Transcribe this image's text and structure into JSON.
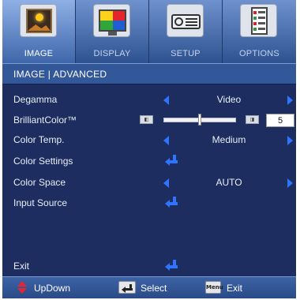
{
  "tabs": [
    {
      "label": "IMAGE",
      "icon": "image-icon",
      "active": true
    },
    {
      "label": "DISPLAY",
      "icon": "display-icon",
      "active": false
    },
    {
      "label": "SETUP",
      "icon": "projector-icon",
      "active": false
    },
    {
      "label": "OPTIONS",
      "icon": "checklist-icon",
      "active": false
    }
  ],
  "menu_title": "IMAGE | ADVANCED",
  "rows": {
    "degamma": {
      "label": "Degamma",
      "value": "Video"
    },
    "brilliantcolor": {
      "label": "BrilliantColor™",
      "value": "5",
      "level_fraction": 0.5
    },
    "color_temp": {
      "label": "Color Temp.",
      "value": "Medium"
    },
    "color_settings": {
      "label": "Color Settings"
    },
    "color_space": {
      "label": "Color Space",
      "value": "AUTO"
    },
    "input_source": {
      "label": "Input Source"
    },
    "exit": {
      "label": "Exit"
    }
  },
  "footer": {
    "updown": "UpDown",
    "select": "Select",
    "menu_key": "Menu",
    "exit": "Exit"
  },
  "colors": {
    "background": "#1d2d5f",
    "accent_arrow": "#2f74ff",
    "updown_icon": "#e8252e"
  }
}
